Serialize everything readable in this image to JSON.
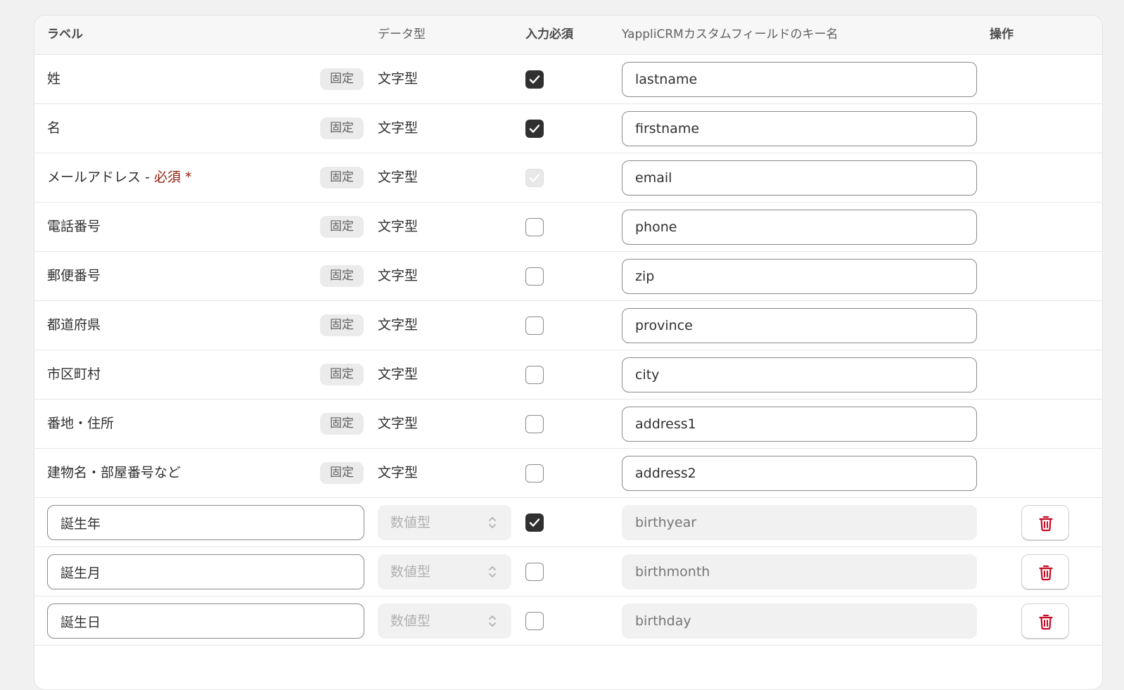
{
  "header": {
    "label": "ラベル",
    "data_type": "データ型",
    "required": "入力必須",
    "key_name": "YappliCRMカスタムフィールドのキー名",
    "actions": "操作"
  },
  "fixed_rows": [
    {
      "label": "姓",
      "badge": "固定",
      "type": "文字型",
      "required": "checked",
      "key": "lastname"
    },
    {
      "label": "名",
      "badge": "固定",
      "type": "文字型",
      "required": "checked",
      "key": "firstname"
    },
    {
      "label": "メールアドレス - ",
      "required_label": "必須 *",
      "badge": "固定",
      "type": "文字型",
      "required": "disabled-checked",
      "key": "email"
    },
    {
      "label": "電話番号",
      "badge": "固定",
      "type": "文字型",
      "required": "unchecked",
      "key": "phone"
    },
    {
      "label": "郵便番号",
      "badge": "固定",
      "type": "文字型",
      "required": "unchecked",
      "key": "zip"
    },
    {
      "label": "都道府県",
      "badge": "固定",
      "type": "文字型",
      "required": "unchecked",
      "key": "province"
    },
    {
      "label": "市区町村",
      "badge": "固定",
      "type": "文字型",
      "required": "unchecked",
      "key": "city"
    },
    {
      "label": "番地・住所",
      "badge": "固定",
      "type": "文字型",
      "required": "unchecked",
      "key": "address1"
    },
    {
      "label": "建物名・部屋番号など",
      "badge": "固定",
      "type": "文字型",
      "required": "unchecked",
      "key": "address2"
    }
  ],
  "custom_rows": [
    {
      "label": "誕生年",
      "type": "数値型",
      "required": "checked",
      "key": "birthyear"
    },
    {
      "label": "誕生月",
      "type": "数値型",
      "required": "unchecked",
      "key": "birthmonth"
    },
    {
      "label": "誕生日",
      "type": "数値型",
      "required": "unchecked",
      "key": "birthday"
    }
  ],
  "colors": {
    "delete_icon": "#c70a24",
    "checkbox_checked": "#303030",
    "required_text": "#8e1f0b"
  },
  "icons": {
    "delete": "trash-icon",
    "select": "chevron-up-down-icon",
    "check": "check-icon"
  }
}
